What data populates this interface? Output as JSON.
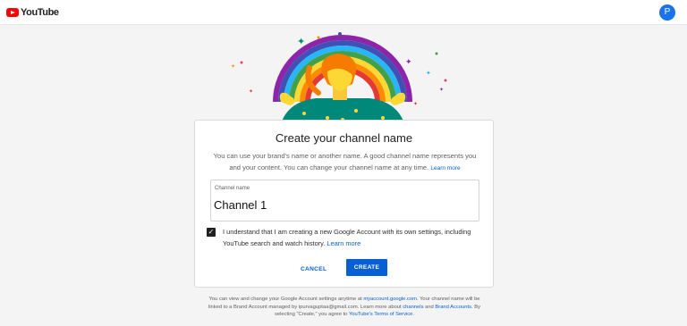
{
  "header": {
    "brand": "YouTube",
    "avatar_initial": "P",
    "icons": [
      "youtube-logo-icon"
    ]
  },
  "dialog": {
    "title": "Create your channel name",
    "description": "You can use your brand's name or another name. A good channel name represents you and your content. You can change your channel name at any time.",
    "learn_more": "Learn more",
    "field_label": "Channel name",
    "field_value": "Channel 1",
    "consent_text": "I understand that I am creating a new Google Account with its own settings, including YouTube search and watch history.",
    "consent_checked": true,
    "consent_learn_more": "Learn more",
    "cancel_label": "CANCEL",
    "create_label": "CREATE"
  },
  "footer": {
    "text1": "You can view and change your Google Account settings anytime at",
    "account_link": "myaccount.google.com",
    "text2": ". Your channel name will be linked to a Brand Account managed by ipurvaguptaa@gmail.com. Learn more about",
    "channels_link": "channels",
    "and": "and",
    "brand_accounts_link": "Brand Accounts",
    "text3": ". By selecting \"Create,\" you agree to",
    "terms_link": "YouTube's Terms of Service",
    "period": "."
  },
  "colors": {
    "brand_red": "#ff0000",
    "link_blue": "#065fd4",
    "avatar_blue": "#1a73e8"
  }
}
